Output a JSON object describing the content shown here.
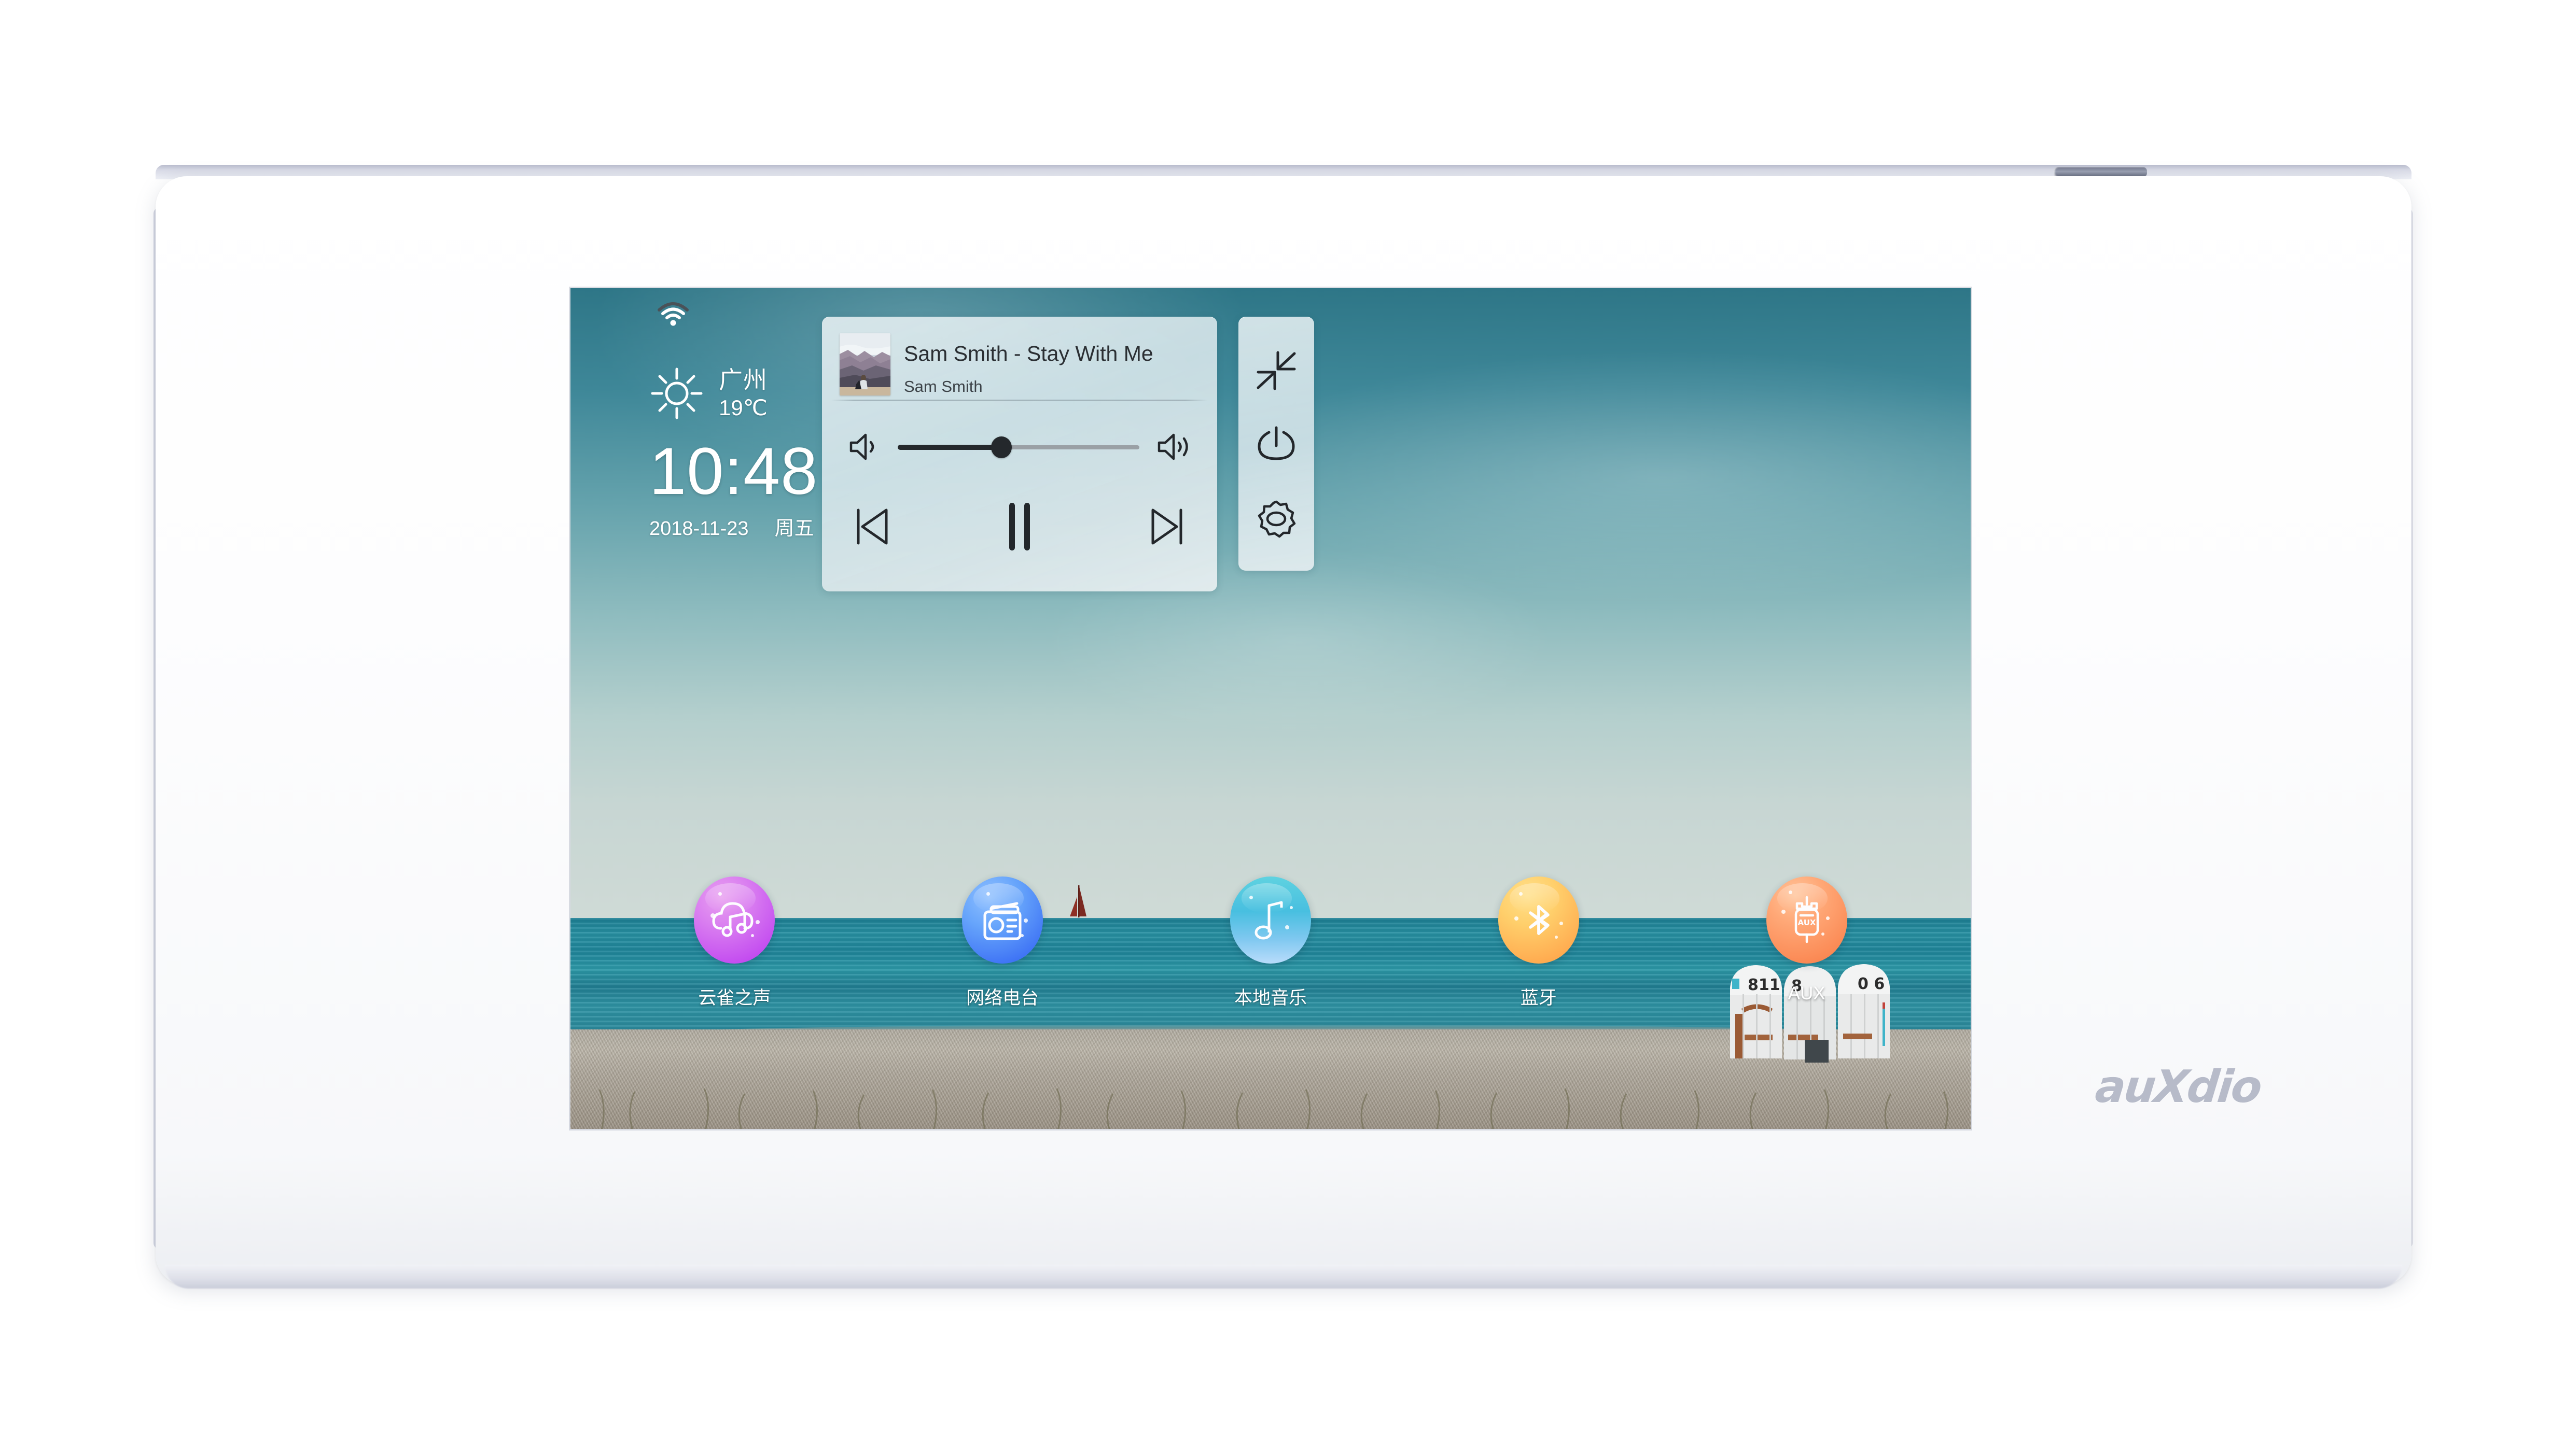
{
  "device": {
    "brand_logo_text": "auXdio",
    "hardware_tab": "top-clip"
  },
  "status_bar": {
    "wifi_icon": "wifi-icon"
  },
  "weather": {
    "icon": "sun-icon",
    "city": "广州",
    "temperature": "19℃"
  },
  "clock": {
    "time": "10:48",
    "date": "2018-11-23",
    "weekday": "周五"
  },
  "music_panel": {
    "album_art_alt": "album-art",
    "track_title": "Sam Smith - Stay With Me",
    "artist": "Sam Smith",
    "volume": {
      "low_icon": "volume-low-icon",
      "high_icon": "volume-high-icon",
      "level_percent": 43
    },
    "transport": {
      "previous_icon": "previous-track-icon",
      "play_state": "paused",
      "play_pause_icon": "pause-icon",
      "next_icon": "next-track-icon"
    }
  },
  "side_panel": {
    "buttons": [
      {
        "name": "collapse-button",
        "icon": "collapse-arrows-icon"
      },
      {
        "name": "power-button",
        "icon": "power-icon"
      },
      {
        "name": "settings-button",
        "icon": "gear-icon"
      }
    ]
  },
  "dock": {
    "items": [
      {
        "label": "云雀之声",
        "icon": "cloud-music-icon",
        "color": "#c44ef0"
      },
      {
        "label": "网络电台",
        "icon": "radio-icon",
        "color": "#3f74f5"
      },
      {
        "label": "本地音乐",
        "icon": "music-note-icon",
        "color": "#48bfe0"
      },
      {
        "label": "蓝牙",
        "icon": "bluetooth-icon",
        "color": "#ffae52"
      },
      {
        "label": "AUX",
        "icon": "aux-plug-icon",
        "color": "#fb8a55"
      }
    ]
  },
  "wallpaper": {
    "scene": "beach-sea-sky",
    "beach_hut_numbers": [
      "811",
      "8",
      "0",
      "6"
    ],
    "sky_color": "#3e8798",
    "sea_color": "#2790a2",
    "sand_color": "#b3aea3"
  },
  "aux_icon_text": "AUX"
}
